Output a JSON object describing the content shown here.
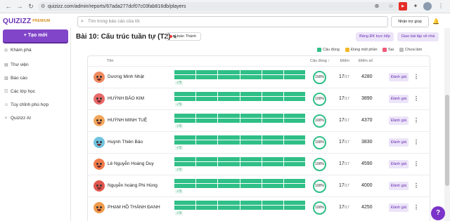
{
  "browser": {
    "url": "quizizz.com/admin/reports/67ada277dcf07c03fab816db/players"
  },
  "app": {
    "brand": "QUIZIZZ",
    "brand_badge": "PREMIUM",
    "search_placeholder": "Tìm trong báo cáo của tôi",
    "help_label": "Nhận trợ giúp"
  },
  "sidebar": {
    "create_label": "+ Tạo mới",
    "items": [
      {
        "label": "Khám phá",
        "icon": "compass-icon"
      },
      {
        "label": "Thư viện",
        "icon": "library-icon"
      },
      {
        "label": "Báo cáo",
        "icon": "report-icon"
      },
      {
        "label": "Các lớp học",
        "icon": "classes-icon"
      },
      {
        "label": "Tùy chỉnh phù hợp",
        "icon": "accommodation-icon"
      },
      {
        "label": "Quizizz AI",
        "icon": "ai-icon"
      }
    ]
  },
  "report": {
    "title": "Bài 10: Cấu trúc tuần tự (T2)",
    "status": "Hoàn Thành",
    "live_button": "Bảng ĐK trực tiếp",
    "assign_button": "Giao bài tập về nhà",
    "legend": [
      {
        "label": "Câu đúng",
        "color": "#2fbf87"
      },
      {
        "label": "Đúng một phần",
        "color": "#f2b829"
      },
      {
        "label": "Sai",
        "color": "#ef5b7a"
      },
      {
        "label": "Chưa làm",
        "color": "#bdbdbd"
      }
    ],
    "columns": {
      "name": "Tên",
      "accuracy": "Câu đúng ↑",
      "score": "Điểm",
      "points": "Điểm số"
    },
    "grade_label": "Đánh giá",
    "players": [
      {
        "name": "Dương Minh Nhật",
        "streak": "✓5",
        "accuracy": "100%",
        "correct": "17",
        "total": "/17",
        "points": "4280",
        "avatar_color": "#f08a5d"
      },
      {
        "name": "HUỲNH BẢO KIM",
        "streak": "✓5",
        "accuracy": "100%",
        "correct": "17",
        "total": "/17",
        "points": "3890",
        "avatar_color": "#e86a6a"
      },
      {
        "name": "HUỲNH MINH TUỆ",
        "streak": "✓5",
        "accuracy": "100%",
        "correct": "17",
        "total": "/17",
        "points": "4370",
        "avatar_color": "#f2a65a"
      },
      {
        "name": "Huỳnh Thiên Bảo",
        "streak": "✓5",
        "accuracy": "100%",
        "correct": "17",
        "total": "/17",
        "points": "3830",
        "avatar_color": "#6fc3df"
      },
      {
        "name": "Lê Nguyễn Hoàng Duy",
        "streak": "✓5",
        "accuracy": "100%",
        "correct": "17",
        "total": "/17",
        "points": "4590",
        "avatar_color": "#f07b4a"
      },
      {
        "name": "Nguyễn hoàng Phi Hùng",
        "streak": "✓5",
        "accuracy": "100%",
        "correct": "17",
        "total": "/17",
        "points": "4000",
        "avatar_color": "#e0574f"
      },
      {
        "name": "PHẠM HỒ THÀNH ĐANH",
        "streak": "✓5",
        "accuracy": "100%",
        "correct": "17",
        "total": "/17",
        "points": "4250",
        "avatar_color": "#f09a4a"
      }
    ]
  }
}
